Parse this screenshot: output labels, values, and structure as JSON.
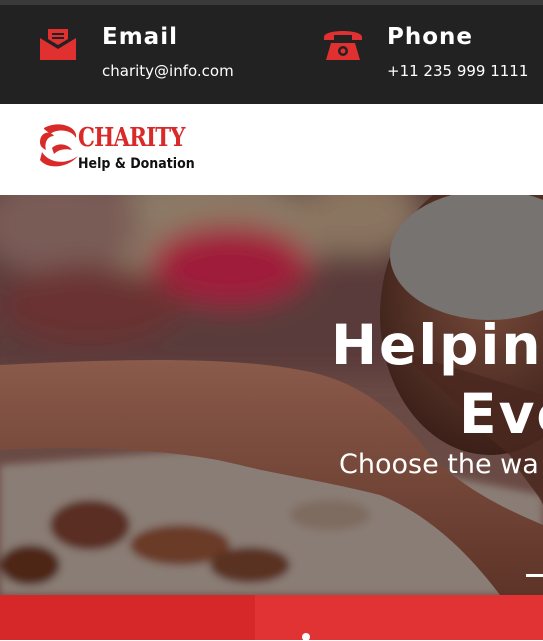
{
  "contact": {
    "email": {
      "title": "Email",
      "value": "charity@info.com",
      "icon": "envelope-icon"
    },
    "phone": {
      "title": "Phone",
      "value": "+11 235 999 1111",
      "icon": "telephone-icon"
    }
  },
  "logo": {
    "name": "CHARITY",
    "tagline": "Help & Donation"
  },
  "hero": {
    "heading_line1": "Helping",
    "heading_line2": "Eve",
    "subheading": "Choose the wa"
  },
  "colors": {
    "accent": "#d92a2a",
    "topbar": "#222222",
    "bottom_left": "#d62828",
    "bottom_right": "#e13333"
  }
}
